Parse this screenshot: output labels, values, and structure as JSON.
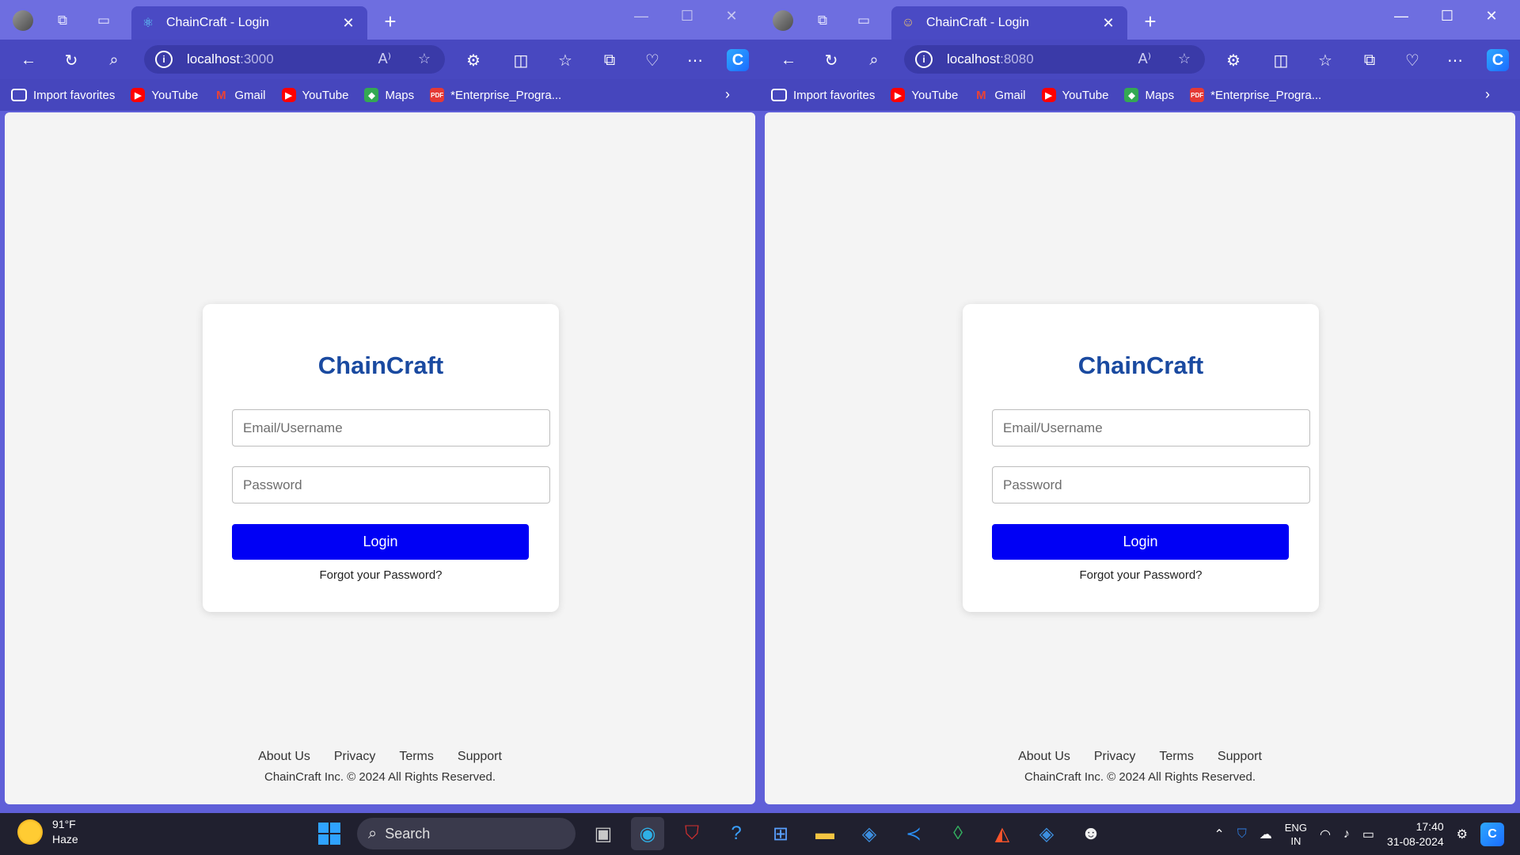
{
  "windows": [
    {
      "tab_title": "ChainCraft - Login",
      "address_host": "localhost",
      "address_port": ":3000",
      "favorites": [
        "Import favorites",
        "YouTube",
        "Gmail",
        "YouTube",
        "Maps",
        "*Enterprise_Progra..."
      ],
      "page": {
        "brand": "ChainCraft",
        "email_placeholder": "Email/Username",
        "password_placeholder": "Password",
        "login_label": "Login",
        "forgot_label": "Forgot your Password?",
        "footer_links": [
          "About Us",
          "Privacy",
          "Terms",
          "Support"
        ],
        "copyright": "ChainCraft Inc. © 2024 All Rights Reserved."
      }
    },
    {
      "tab_title": "ChainCraft - Login",
      "address_host": "localhost",
      "address_port": ":8080",
      "favorites": [
        "Import favorites",
        "YouTube",
        "Gmail",
        "YouTube",
        "Maps",
        "*Enterprise_Progra..."
      ],
      "page": {
        "brand": "ChainCraft",
        "email_placeholder": "Email/Username",
        "password_placeholder": "Password",
        "login_label": "Login",
        "forgot_label": "Forgot your Password?",
        "footer_links": [
          "About Us",
          "Privacy",
          "Terms",
          "Support"
        ],
        "copyright": "ChainCraft Inc. © 2024 All Rights Reserved."
      }
    }
  ],
  "taskbar": {
    "weather_temp": "91°F",
    "weather_desc": "Haze",
    "search_label": "Search",
    "lang_top": "ENG",
    "lang_bottom": "IN",
    "time": "17:40",
    "date": "31-08-2024"
  },
  "colors": {
    "titlebar": "#6e6ee0",
    "brand_text": "#1a4aa0",
    "login_button": "#0000f5",
    "page_background": "#f4f4f4"
  }
}
